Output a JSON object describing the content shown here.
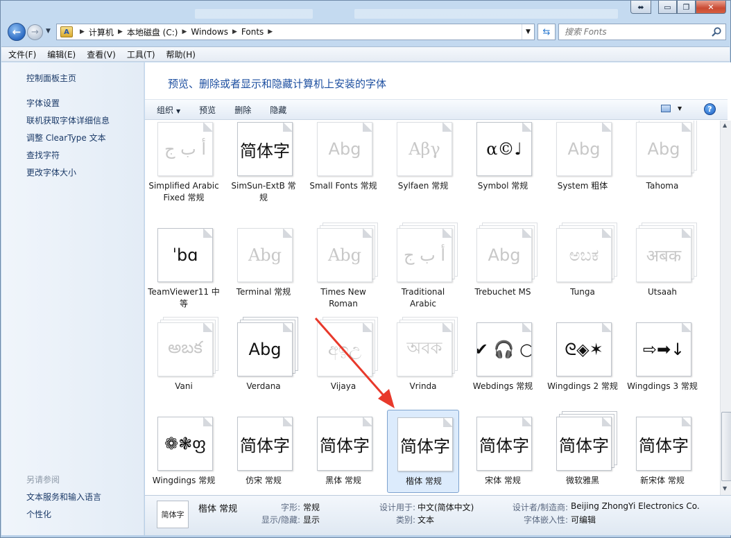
{
  "window": {
    "caption": {
      "min": "▭",
      "restore": "❐",
      "close": "✕",
      "extra": "⬌"
    }
  },
  "address": {
    "crumbs": [
      "计算机",
      "本地磁盘 (C:)",
      "Windows",
      "Fonts"
    ],
    "search_placeholder": "搜索 Fonts"
  },
  "menu": [
    "文件(F)",
    "编辑(E)",
    "查看(V)",
    "工具(T)",
    "帮助(H)"
  ],
  "nav": {
    "home": "控制面板主页",
    "links": [
      "字体设置",
      "联机获取字体详细信息",
      "调整 ClearType 文本",
      "查找字符",
      "更改字体大小"
    ],
    "see_also_heading": "另请参阅",
    "see_also": [
      "文本服务和输入语言",
      "个性化"
    ]
  },
  "content": {
    "title": "预览、删除或者显示和隐藏计算机上安装的字体",
    "commands": {
      "organize": "组织",
      "preview": "预览",
      "delete": "删除",
      "hide": "隐藏"
    }
  },
  "fonts": [
    {
      "sample": "أ ب ج",
      "label": "Simplified Arabic Fixed 常规",
      "faded": true,
      "stacked": false,
      "serif": false
    },
    {
      "sample": "简体字",
      "label": "SimSun-ExtB 常规",
      "faded": false,
      "stacked": false,
      "serif": true
    },
    {
      "sample": "Abg",
      "label": "Small Fonts 常规",
      "faded": true,
      "stacked": false,
      "serif": false
    },
    {
      "sample": "Αβγ",
      "label": "Sylfaen 常规",
      "faded": true,
      "stacked": false,
      "serif": true
    },
    {
      "sample": "α©♩",
      "label": "Symbol 常规",
      "faded": false,
      "stacked": false,
      "serif": true
    },
    {
      "sample": "Abg",
      "label": "System 粗体",
      "faded": true,
      "stacked": false,
      "serif": false
    },
    {
      "sample": "Abg",
      "label": "Tahoma",
      "faded": true,
      "stacked": true,
      "serif": false
    },
    {
      "sample": "ˈbɑ",
      "label": "TeamViewer11 中等",
      "faded": false,
      "stacked": false,
      "serif": false
    },
    {
      "sample": "Abg",
      "label": "Terminal 常规",
      "faded": true,
      "stacked": false,
      "serif": true
    },
    {
      "sample": "Abg",
      "label": "Times New Roman",
      "faded": true,
      "stacked": true,
      "serif": true
    },
    {
      "sample": "أ ب ج",
      "label": "Traditional Arabic",
      "faded": true,
      "stacked": true,
      "serif": true
    },
    {
      "sample": "Abg",
      "label": "Trebuchet MS",
      "faded": true,
      "stacked": true,
      "serif": false
    },
    {
      "sample": "ಅಬಕ",
      "label": "Tunga",
      "faded": true,
      "stacked": true,
      "serif": false
    },
    {
      "sample": "अबक",
      "label": "Utsaah",
      "faded": true,
      "stacked": true,
      "serif": false
    },
    {
      "sample": "అబక",
      "label": "Vani",
      "faded": true,
      "stacked": true,
      "serif": false
    },
    {
      "sample": "Abg",
      "label": "Verdana",
      "faded": false,
      "stacked": true,
      "serif": false
    },
    {
      "sample": "අඉඋ",
      "label": "Vijaya",
      "faded": true,
      "stacked": true,
      "serif": false
    },
    {
      "sample": "অবক",
      "label": "Vrinda",
      "faded": true,
      "stacked": true,
      "serif": false
    },
    {
      "sample": "✔ 🎧 ○",
      "label": "Webdings 常规",
      "faded": false,
      "stacked": false,
      "serif": false
    },
    {
      "sample": "ᘓ◈✶",
      "label": "Wingdings 2 常规",
      "faded": false,
      "stacked": false,
      "serif": false
    },
    {
      "sample": "⇨➡↓",
      "label": "Wingdings 3 常规",
      "faded": false,
      "stacked": false,
      "serif": false
    },
    {
      "sample": "❁❃ფ",
      "label": "Wingdings 常规",
      "faded": false,
      "stacked": false,
      "serif": false
    },
    {
      "sample": "简体字",
      "label": "仿宋 常规",
      "faded": false,
      "stacked": false,
      "serif": true
    },
    {
      "sample": "简体字",
      "label": "黑体 常规",
      "faded": false,
      "stacked": false,
      "serif": false
    },
    {
      "sample": "简体字",
      "label": "楷体 常规",
      "faded": false,
      "stacked": false,
      "serif": true,
      "selected": true
    },
    {
      "sample": "简体字",
      "label": "宋体 常规",
      "faded": false,
      "stacked": false,
      "serif": true
    },
    {
      "sample": "简体字",
      "label": "微软雅黑",
      "faded": false,
      "stacked": true,
      "serif": false
    },
    {
      "sample": "简体字",
      "label": "新宋体 常规",
      "faded": false,
      "stacked": false,
      "serif": true
    }
  ],
  "details": {
    "thumb": "简体字",
    "name": "楷体 常规",
    "style_label": "字形:",
    "style_value": "常规",
    "visibility_label": "显示/隐藏:",
    "visibility_value": "显示",
    "designed_for_label": "设计用于:",
    "designed_for_value": "中文(简体中文)",
    "category_label": "类别:",
    "category_value": "文本",
    "designer_label": "设计者/制造商:",
    "designer_value": "Beijing ZhongYi Electronics Co.",
    "embed_label": "字体嵌入性:",
    "embed_value": "可编辑"
  },
  "colors": {
    "accent": "#1d4fa0",
    "annotation": "#e8392b",
    "selection": "#dcebfc"
  }
}
